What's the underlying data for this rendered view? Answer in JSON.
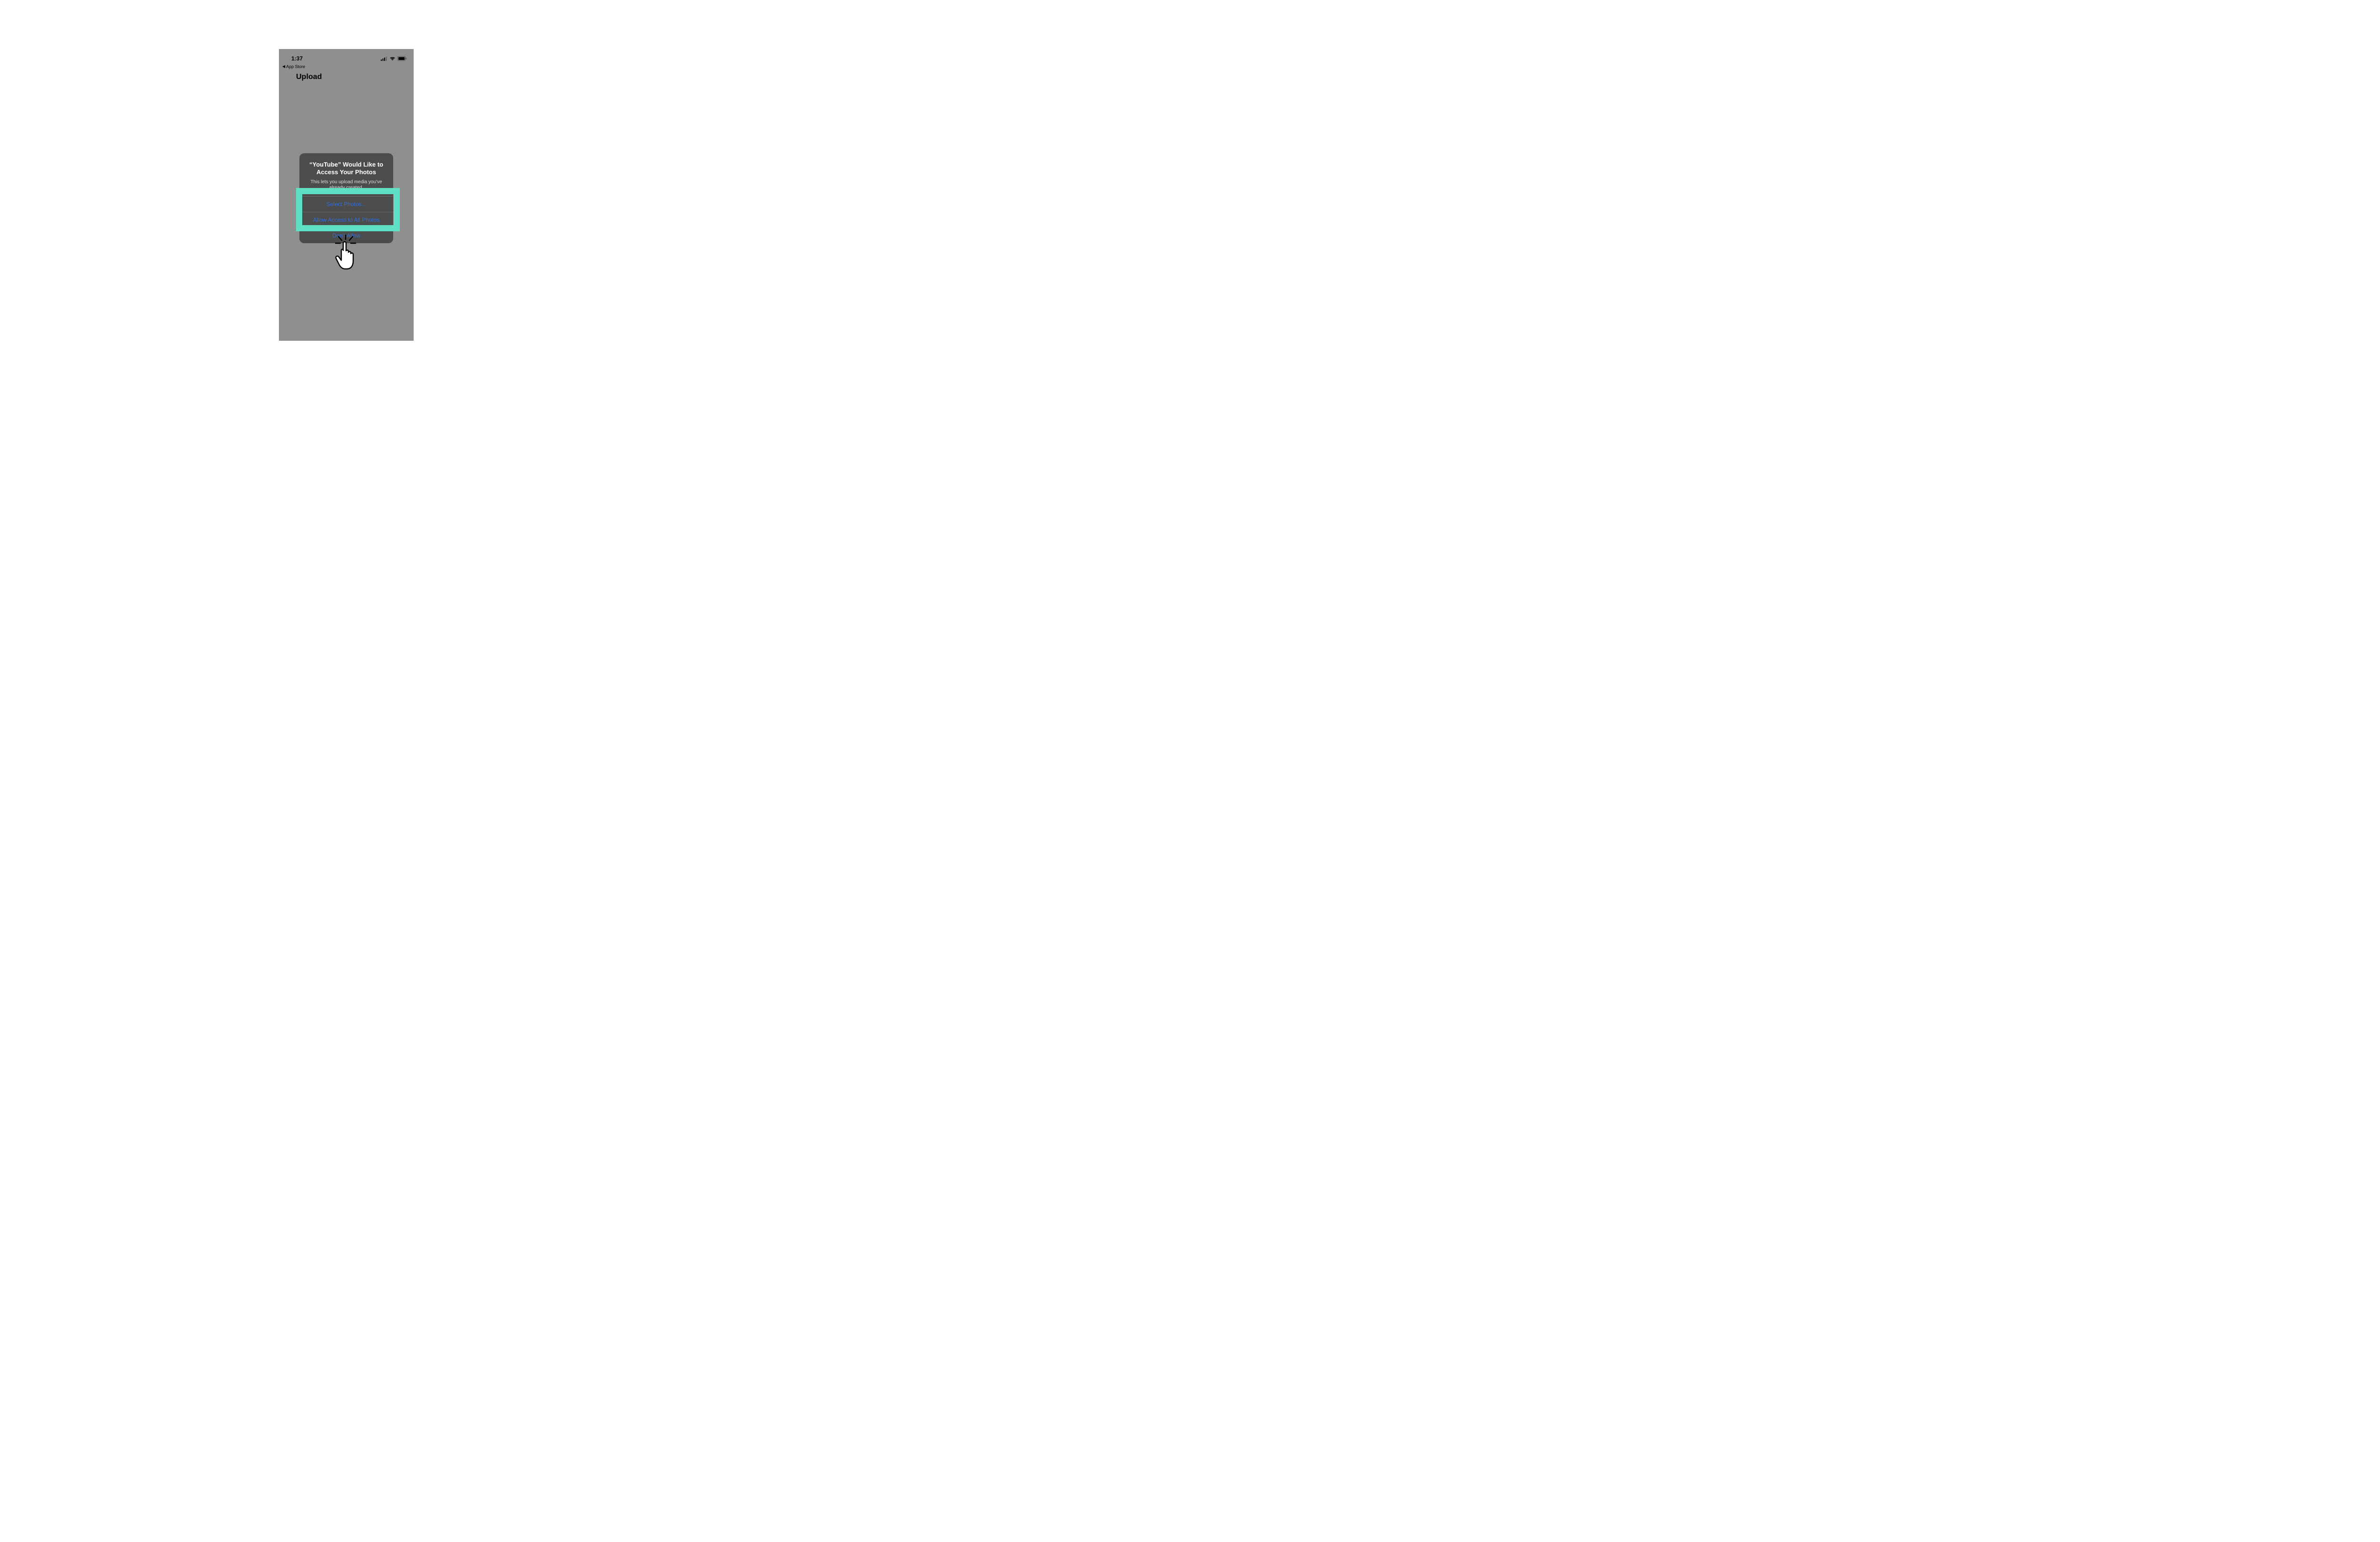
{
  "status": {
    "time": "1:37",
    "back_label": "App Store"
  },
  "screen": {
    "title": "Upload"
  },
  "alert": {
    "title": "“YouTube” Would Like to Access Your Photos",
    "message": "This lets you upload media you've already created.",
    "buttons": {
      "select": "Select Photos...",
      "allow_all": "Allow Access to All Photos",
      "deny": "Don't Allow"
    }
  },
  "highlight": {
    "color": "#5fe0c5"
  }
}
